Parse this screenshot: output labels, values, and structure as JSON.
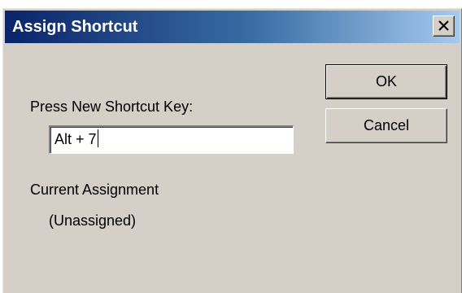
{
  "window": {
    "title": "Assign Shortcut",
    "close_icon": "close-icon"
  },
  "form": {
    "press_label": "Press New Shortcut Key:",
    "shortcut_value": "Alt + 7",
    "current_label": "Current Assignment",
    "current_value": "(Unassigned)"
  },
  "buttons": {
    "ok_label": "OK",
    "cancel_label": "Cancel"
  },
  "colors": {
    "title_bar_start": "#0a246a",
    "title_bar_end": "#a6caf0",
    "dialog_face": "#d4d0c8"
  }
}
